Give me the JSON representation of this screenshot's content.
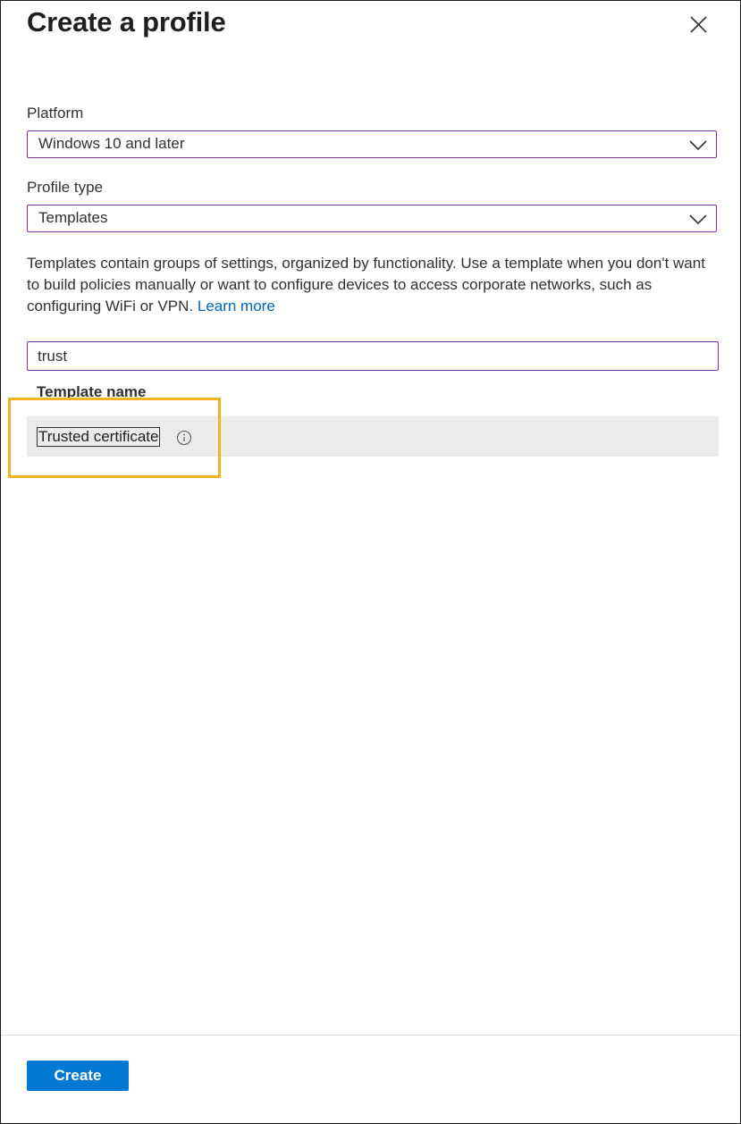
{
  "dialog": {
    "title": "Create a profile"
  },
  "platform": {
    "label": "Platform",
    "value": "Windows 10 and later"
  },
  "profile_type": {
    "label": "Profile type",
    "value": "Templates"
  },
  "description": {
    "text": "Templates contain groups of settings, organized by functionality. Use a template when you don't want to build policies manually or want to configure devices to access corporate networks, such as configuring WiFi or VPN.",
    "link_label": "Learn more"
  },
  "search": {
    "value": "trust"
  },
  "table": {
    "column_header": "Template name",
    "rows": [
      {
        "name": "Trusted certificate"
      }
    ]
  },
  "footer": {
    "create_label": "Create"
  },
  "colors": {
    "accent": "#0078d4",
    "focus_border": "#8a2da5",
    "highlight": "#f5b41e",
    "link": "#0067b8",
    "row_selected": "#edebe9"
  },
  "icons": {
    "close": "close-icon",
    "chevron": "chevron-down-icon",
    "info": "info-icon"
  }
}
